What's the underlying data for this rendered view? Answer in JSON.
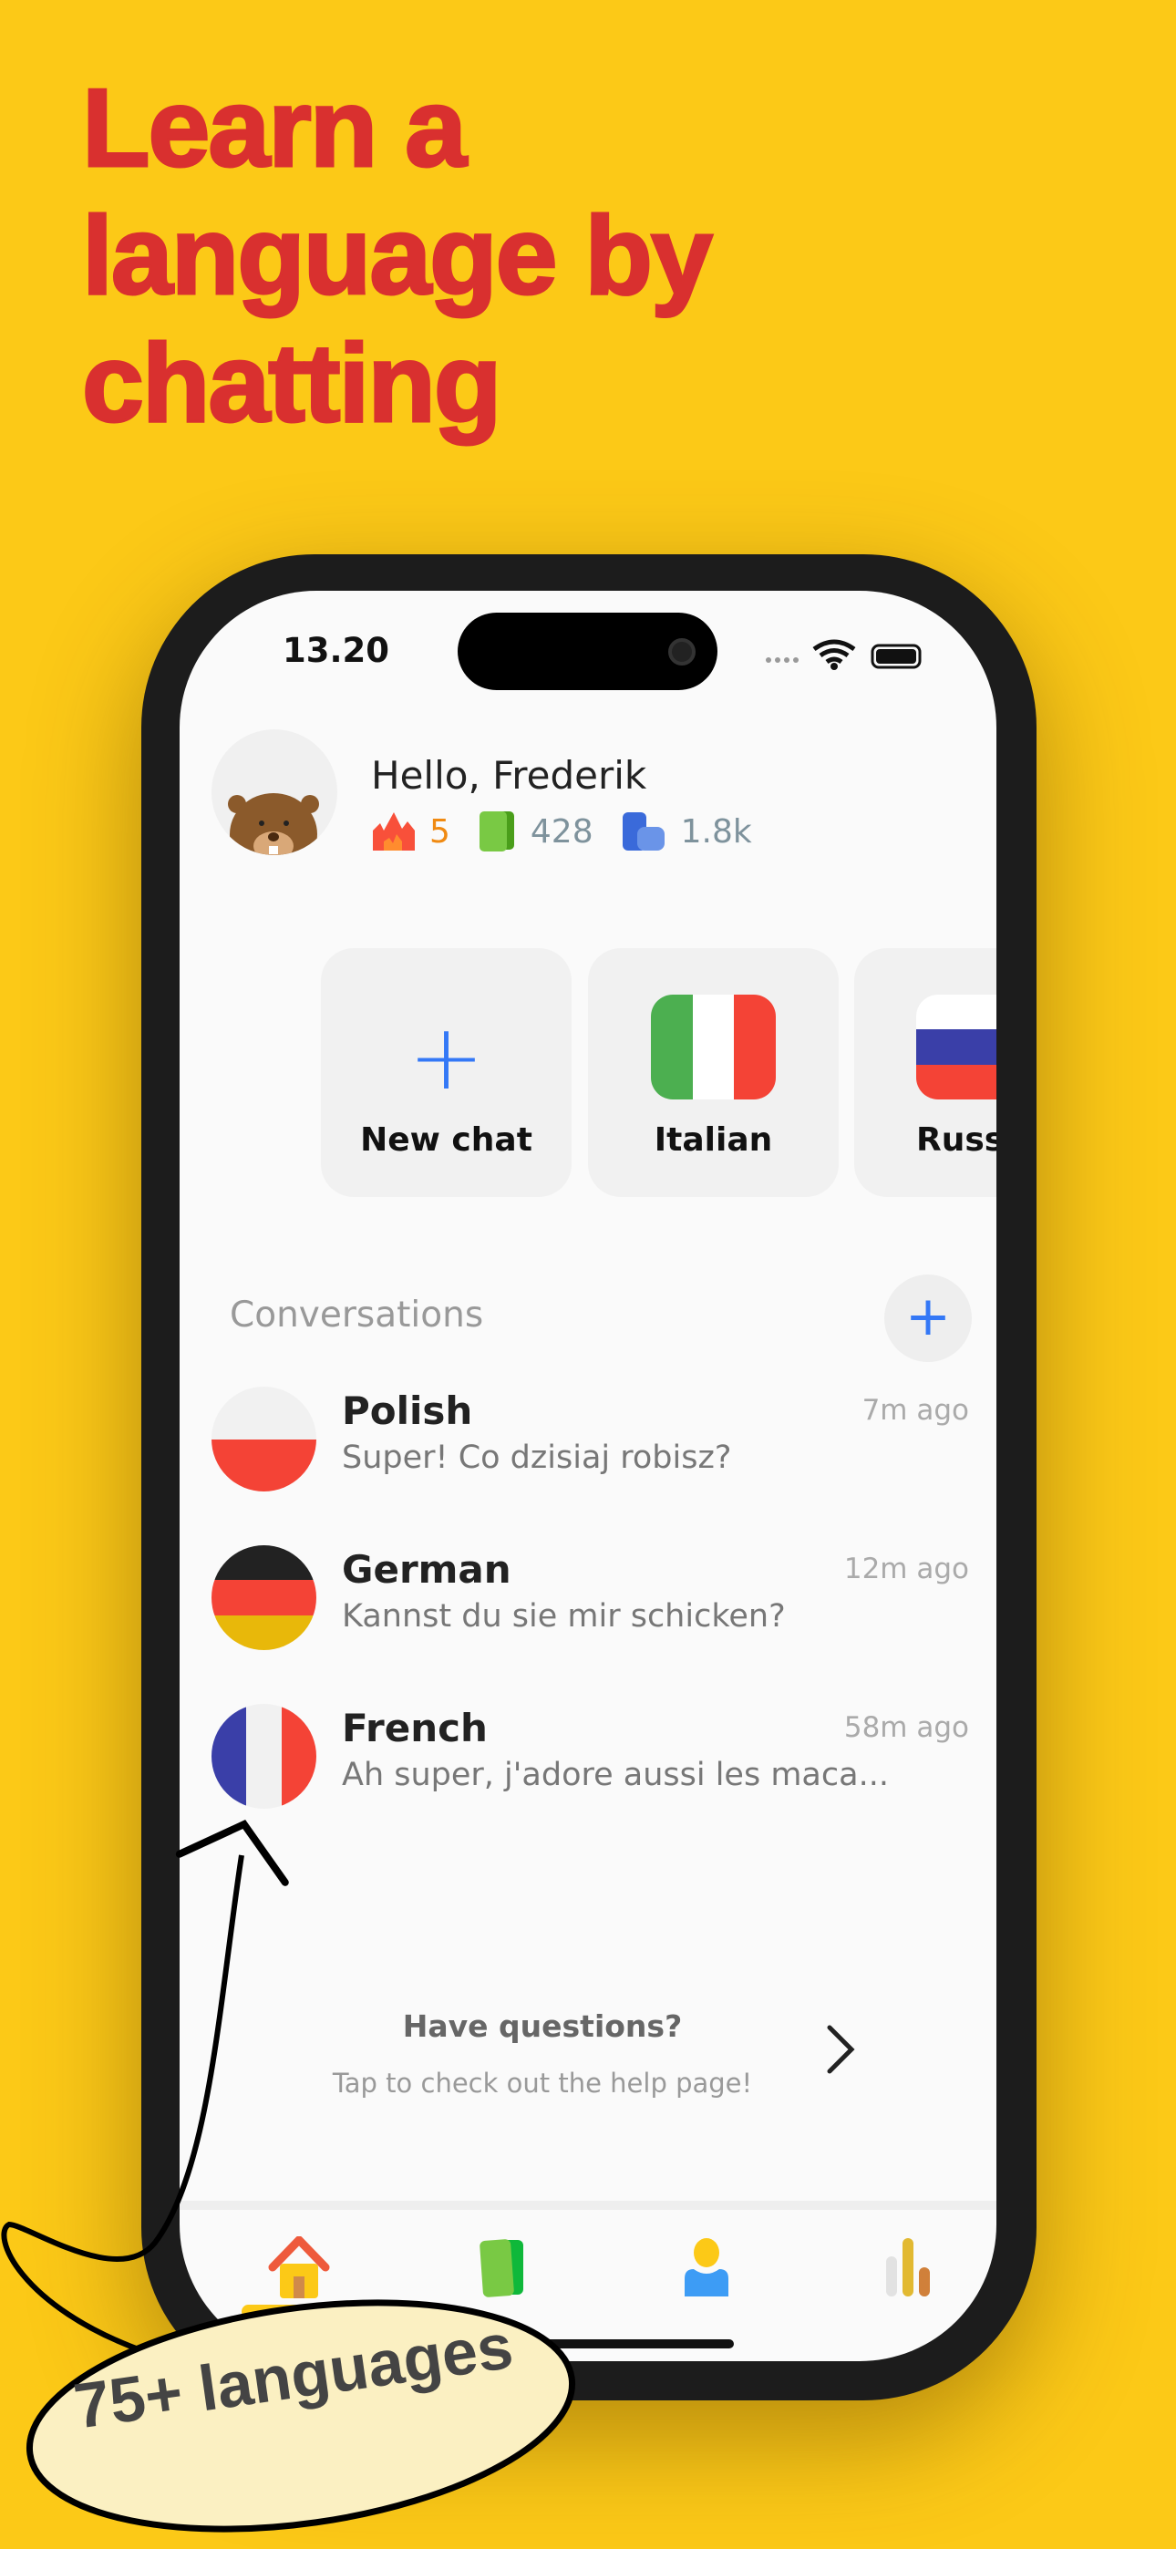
{
  "headline": [
    "Learn a",
    "language by",
    "chatting"
  ],
  "status_bar": {
    "time": "13.20"
  },
  "profile": {
    "greeting": "Hello, Frederik",
    "streak": "5",
    "cards": "428",
    "words": "1.8k"
  },
  "quick_start": [
    {
      "label": "New chat",
      "icon": "plus-icon"
    },
    {
      "label": "Italian",
      "icon": "italy-flag"
    },
    {
      "label": "Russi",
      "icon": "russia-flag"
    }
  ],
  "conversations": {
    "header": "Conversations",
    "items": [
      {
        "language": "Polish",
        "message": "Super! Co dzisiaj robisz?",
        "time": "7m ago"
      },
      {
        "language": "German",
        "message": "Kannst du sie mir schicken?",
        "time": "12m ago"
      },
      {
        "language": "French",
        "message": "Ah super, j'adore aussi les maca...",
        "time": "58m ago"
      }
    ]
  },
  "help": {
    "title": "Have questions?",
    "subtitle": "Tap to check out the help page!"
  },
  "tabs": [
    {
      "icon": "home-icon",
      "active": true
    },
    {
      "icon": "cards-icon"
    },
    {
      "icon": "profile-icon"
    },
    {
      "icon": "stats-icon"
    }
  ],
  "annotation": "75+ languages",
  "colors": {
    "background": "#FCC917",
    "headline": "#D9302F",
    "accent": "#3478F6"
  }
}
